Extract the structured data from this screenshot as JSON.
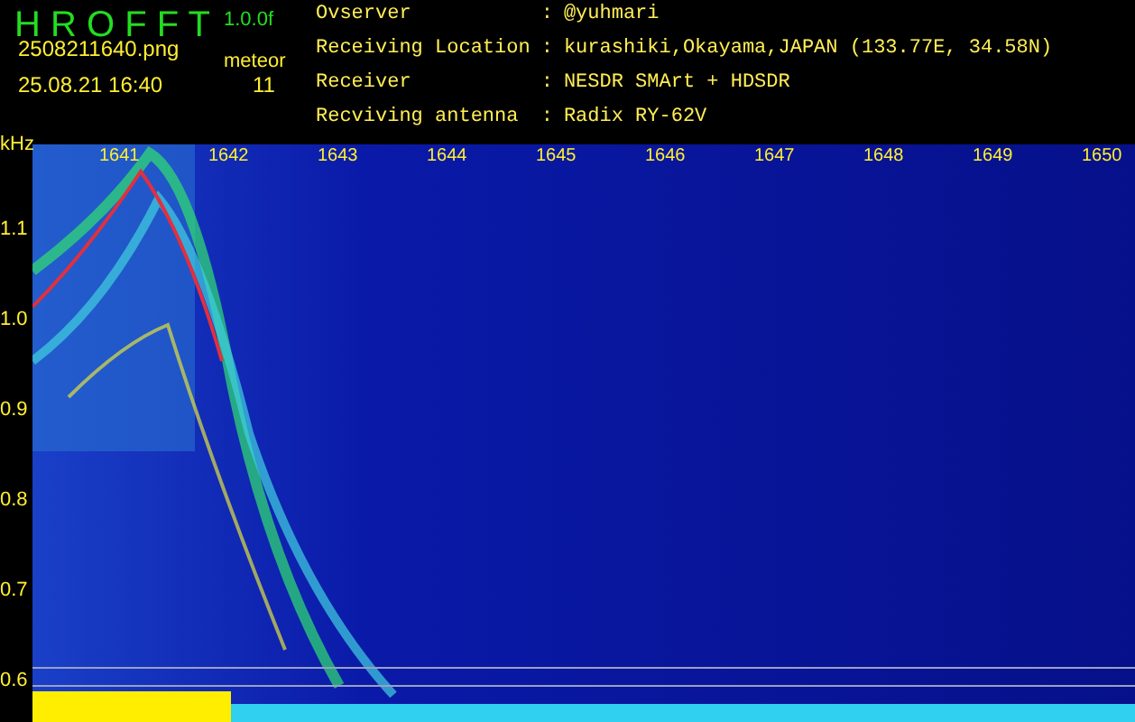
{
  "header": {
    "title": "H R O F F T",
    "version": "1.0.0f",
    "filename": "2508211640.png",
    "timestamp": "25.08.21 16:40",
    "count_label": "meteor",
    "count": "11"
  },
  "info": [
    {
      "label": "Ovserver",
      "sep": ":",
      "value": "@yuhmari"
    },
    {
      "label": "Receiving Location",
      "sep": ":",
      "value": "kurashiki,Okayama,JAPAN (133.77E, 34.58N)"
    },
    {
      "label": "Receiver",
      "sep": ":",
      "value": "NESDR SMArt + HDSDR"
    },
    {
      "label": "Recviving antenna",
      "sep": ":",
      "value": "Radix RY-62V"
    }
  ],
  "axis": {
    "unit": "kHz",
    "y_labels": [
      "1.1",
      "1.0",
      "0.9",
      "0.8",
      "0.7",
      "0.6"
    ],
    "x_labels": [
      "1641",
      "1642",
      "1643",
      "1644",
      "1645",
      "1646",
      "1647",
      "1648",
      "1649",
      "1650"
    ]
  }
}
